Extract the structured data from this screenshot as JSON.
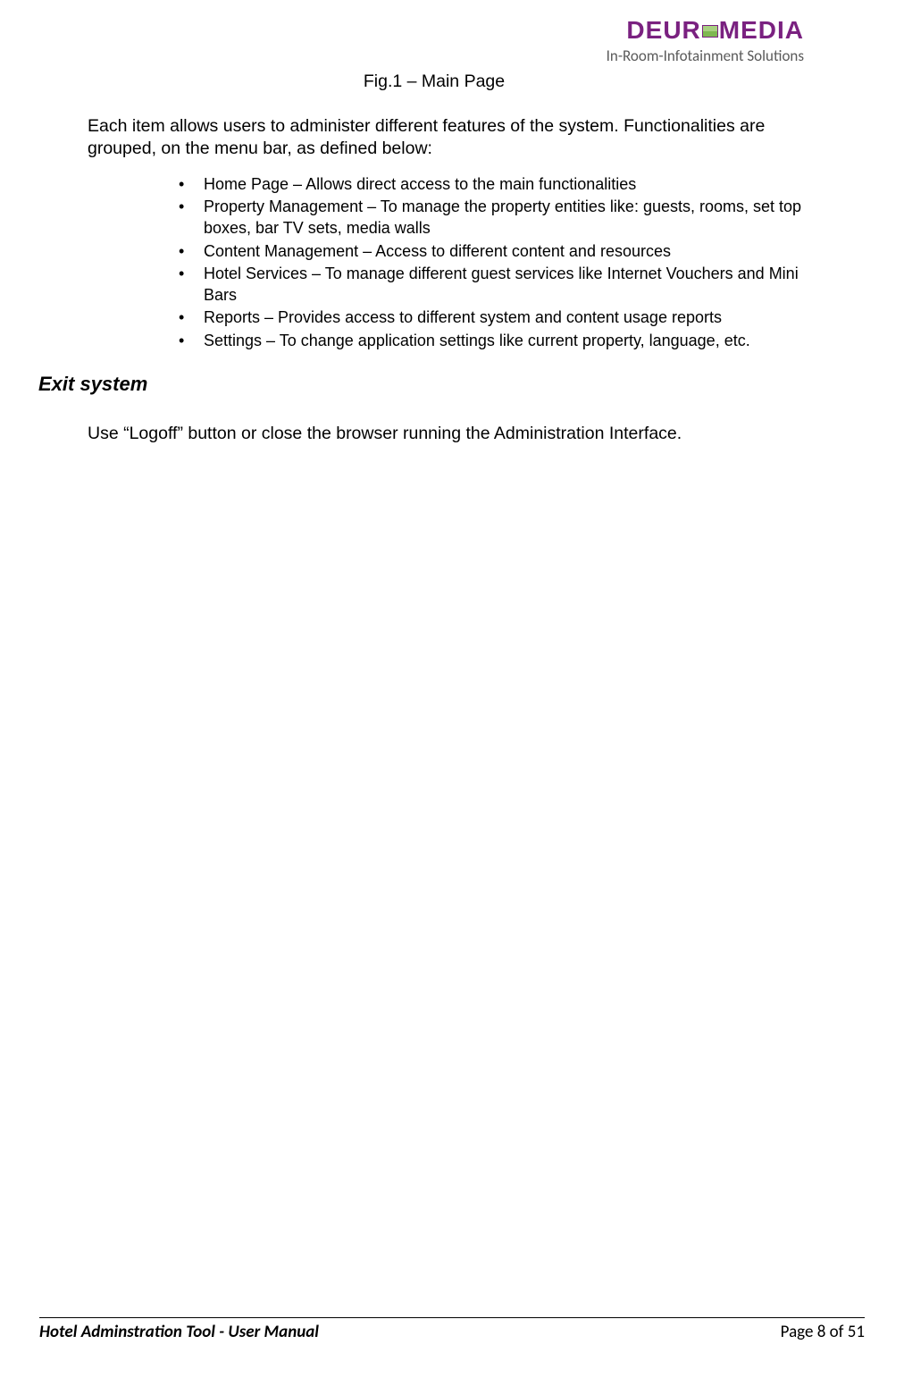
{
  "header": {
    "logo_prefix": "DEUR",
    "logo_suffix": "MEDIA",
    "tagline": "In-Room-Infotainment Solutions"
  },
  "content": {
    "fig_caption": "Fig.1 – Main Page",
    "intro": "Each item allows users to administer different features of the system. Functionalities are grouped, on the menu bar, as defined below:",
    "bullets": [
      "Home Page – Allows direct access to the main functionalities",
      "Property Management – To manage the property entities like: guests, rooms, set top boxes, bar TV sets, media walls",
      "Content Management – Access to different content and resources",
      "Hotel Services – To manage different guest services like Internet Vouchers and Mini Bars",
      "Reports – Provides access to different system and content usage reports",
      "Settings – To change application settings like current property, language, etc."
    ],
    "exit_heading": "Exit system",
    "exit_para": "Use “Logoff” button or close the browser running the Administration Interface."
  },
  "footer": {
    "left": "Hotel Adminstration Tool - User Manual",
    "right": "Page 8 of 51"
  }
}
